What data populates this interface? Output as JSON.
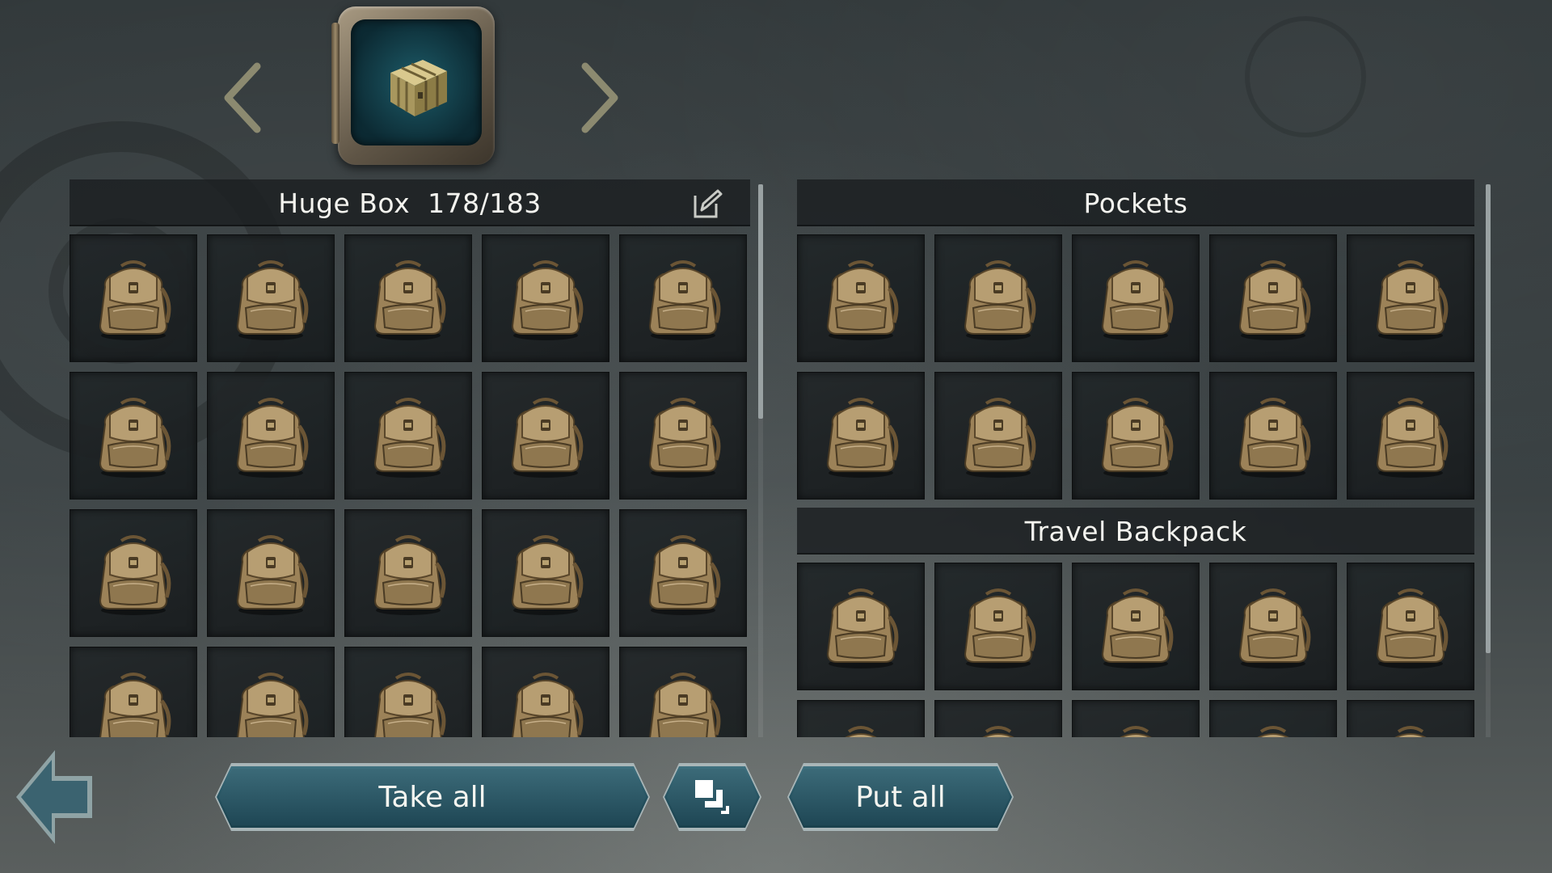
{
  "container": {
    "title": "Huge Box",
    "capacity": "178/183",
    "icon": "crate-icon"
  },
  "left_panel": {
    "slots": [
      "backpack",
      "backpack",
      "backpack",
      "backpack",
      "backpack",
      "backpack",
      "backpack",
      "backpack",
      "backpack",
      "backpack",
      "backpack",
      "backpack",
      "backpack",
      "backpack",
      "backpack",
      "backpack",
      "backpack",
      "backpack",
      "backpack",
      "backpack"
    ]
  },
  "right_panel": {
    "pockets": {
      "title": "Pockets",
      "slots": [
        "backpack",
        "backpack",
        "backpack",
        "backpack",
        "backpack",
        "backpack",
        "backpack",
        "backpack",
        "backpack",
        "backpack"
      ]
    },
    "travel_backpack": {
      "title": "Travel Backpack",
      "slots": [
        "backpack",
        "backpack",
        "backpack",
        "backpack",
        "backpack",
        "backpack",
        "backpack",
        "backpack",
        "backpack",
        "backpack"
      ]
    }
  },
  "buttons": {
    "take_all": "Take all",
    "put_all": "Put all",
    "stack": "stack-icon",
    "back": "back-arrow-icon"
  },
  "colors": {
    "button_teal": "#24505e",
    "arrow_olive": "#8c8a70",
    "item_tan": "#a88d62"
  }
}
